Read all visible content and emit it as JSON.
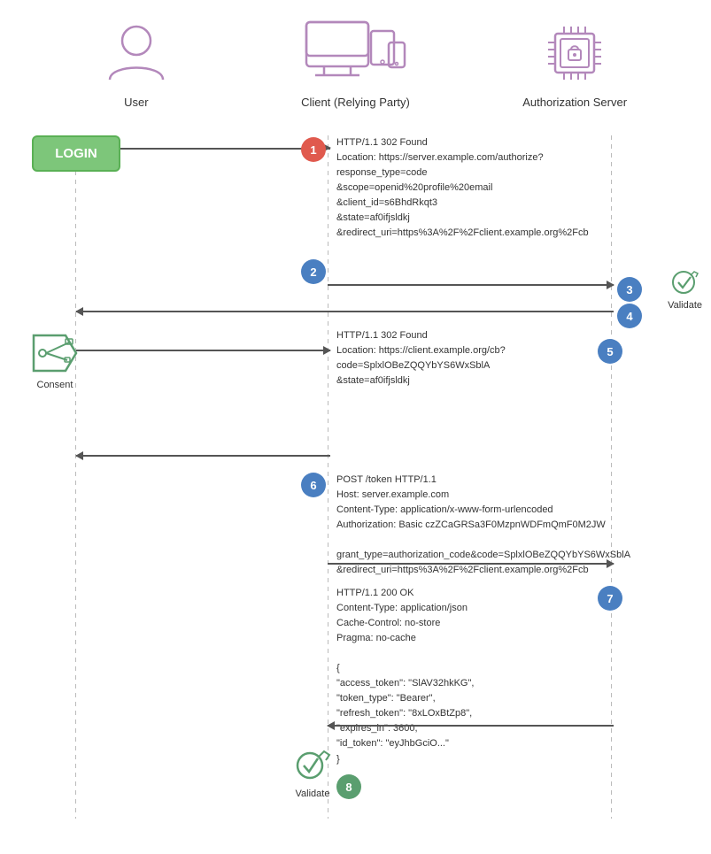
{
  "actors": {
    "user": {
      "label": "User"
    },
    "client": {
      "label": "Client (Relying Party)"
    },
    "auth_server": {
      "label": "Authorization Server"
    }
  },
  "steps": {
    "login_label": "LOGIN",
    "step1": {
      "badge": "1",
      "color": "red",
      "text": "HTTP/1.1 302 Found\nLocation: https://server.example.com/authorize?\nresponse_type=code\n&scope=openid%20profile%20email\n&client_id=s6BhdRkqt3\n&state=af0ifjsldkj\n&redirect_uri=https%3A%2F%2Fclient.example.org%2Fcb"
    },
    "step2": {
      "badge": "2",
      "color": "blue",
      "text": ""
    },
    "step3": {
      "badge": "3",
      "color": "blue"
    },
    "step3_label": "Validate",
    "step4": {
      "badge": "4",
      "color": "blue"
    },
    "step5": {
      "badge": "5",
      "color": "blue",
      "text": "HTTP/1.1 302 Found\nLocation: https://client.example.org/cb?\ncode=SplxlOBeZQQYbYS6WxSblA\n&state=af0ifjsldkj"
    },
    "consent_label": "Consent",
    "step6": {
      "badge": "6",
      "color": "blue",
      "text": "POST /token HTTP/1.1\nHost: server.example.com\nContent-Type: application/x-www-form-urlencoded\nAuthorization: Basic czZCaGRSa3F0MzpnWDFmQmF0M2JW\n\ngrant_type=authorization_code&code=SplxlOBeZQQYbYS6WxSblA\n&redirect_uri=https%3A%2F%2Fclient.example.org%2Fcb"
    },
    "step7": {
      "badge": "7",
      "color": "blue",
      "text": "HTTP/1.1 200 OK\nContent-Type: application/json\nCache-Control: no-store\nPragma: no-cache\n\n{\n\"access_token\": \"SlAV32hkKG\",\n\"token_type\": \"Bearer\",\n\"refresh_token\": \"8xLOxBtZp8\",\n\"expires_in\": 3600,\n\"id_token\": \"eyJhbGciO...\"\n}"
    },
    "step8": {
      "badge": "8",
      "color": "green"
    },
    "step8_label": "Validate"
  },
  "colors": {
    "red": "#e05a4e",
    "blue": "#4a7fc1",
    "green": "#5a9e6f",
    "login_bg": "#7dc67a",
    "line_color": "#555"
  }
}
